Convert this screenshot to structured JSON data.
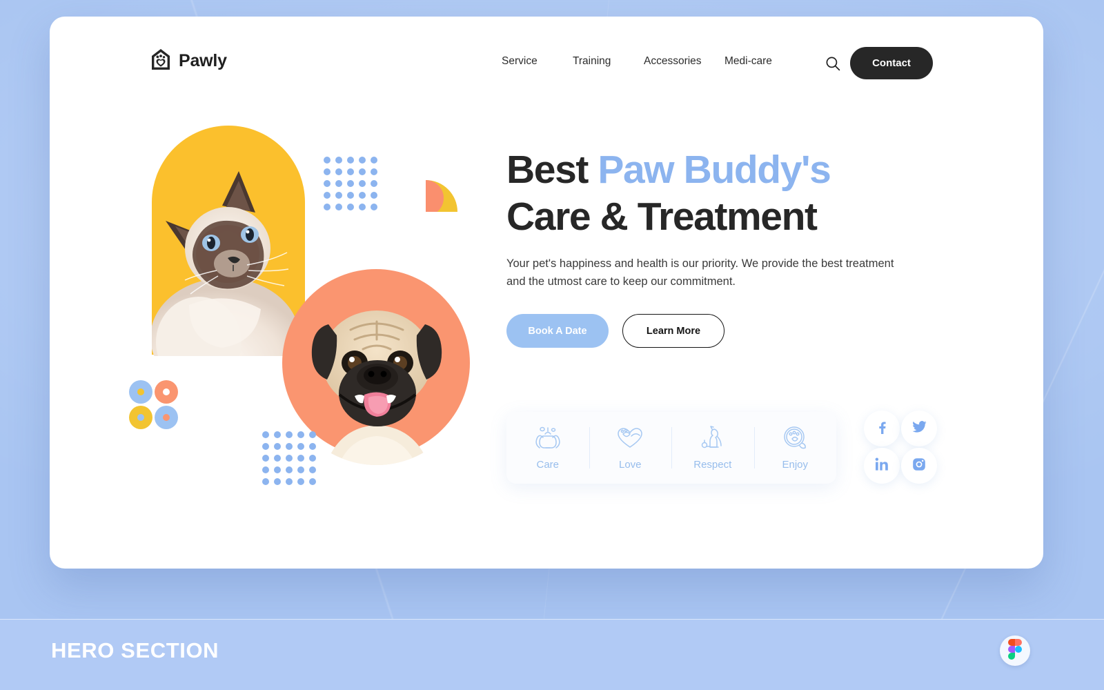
{
  "page": {
    "background_color": "#a9c5f2",
    "card_color": "#ffffff",
    "accent_blue": "#8cb4ef",
    "accent_yellow": "#fbc02d",
    "accent_orange": "#fa9570",
    "dark": "#272727"
  },
  "nav": {
    "logo_text": "Pawly",
    "links": [
      {
        "label": "Service"
      },
      {
        "label": "Training"
      },
      {
        "label": "Accessories"
      },
      {
        "label": "Medi-care"
      }
    ],
    "search_icon": "search-icon",
    "contact_label": "Contact"
  },
  "hero": {
    "headline_part1": "Best ",
    "headline_accent": "Paw Buddy's",
    "headline_part2": "Care & Treatment",
    "subtitle": "Your pet's happiness and health is our priority. We provide the best treatment and the utmost care to keep our commitment.",
    "primary_cta": "Book A Date",
    "secondary_cta": "Learn More"
  },
  "features": [
    {
      "label": "Care",
      "icon": "cat-grooming-icon"
    },
    {
      "label": "Love",
      "icon": "heart-paw-icon"
    },
    {
      "label": "Respect",
      "icon": "sitting-dog-icon"
    },
    {
      "label": "Enjoy",
      "icon": "paw-badge-icon"
    }
  ],
  "socials": [
    {
      "name": "facebook-icon",
      "glyph": "f"
    },
    {
      "name": "twitter-icon",
      "glyph": "t"
    },
    {
      "name": "linkedin-icon",
      "glyph": "in"
    },
    {
      "name": "instagram-icon",
      "glyph": "ig"
    }
  ],
  "decor": {
    "donuts": [
      {
        "ring": "#9cc2f2",
        "center": "#f2c431"
      },
      {
        "ring": "#fa9570",
        "center": "#ffffff"
      },
      {
        "ring": "#f2c431",
        "center": "#9cc2f2"
      },
      {
        "ring": "#9cc2f2",
        "center": "#fa9570"
      }
    ],
    "dot_color": "#8cb4ef",
    "dot_grid_cols": 5,
    "dot_grid_rows": 5
  },
  "footer": {
    "label": "HERO SECTION",
    "badge": "figma-logo-icon"
  }
}
